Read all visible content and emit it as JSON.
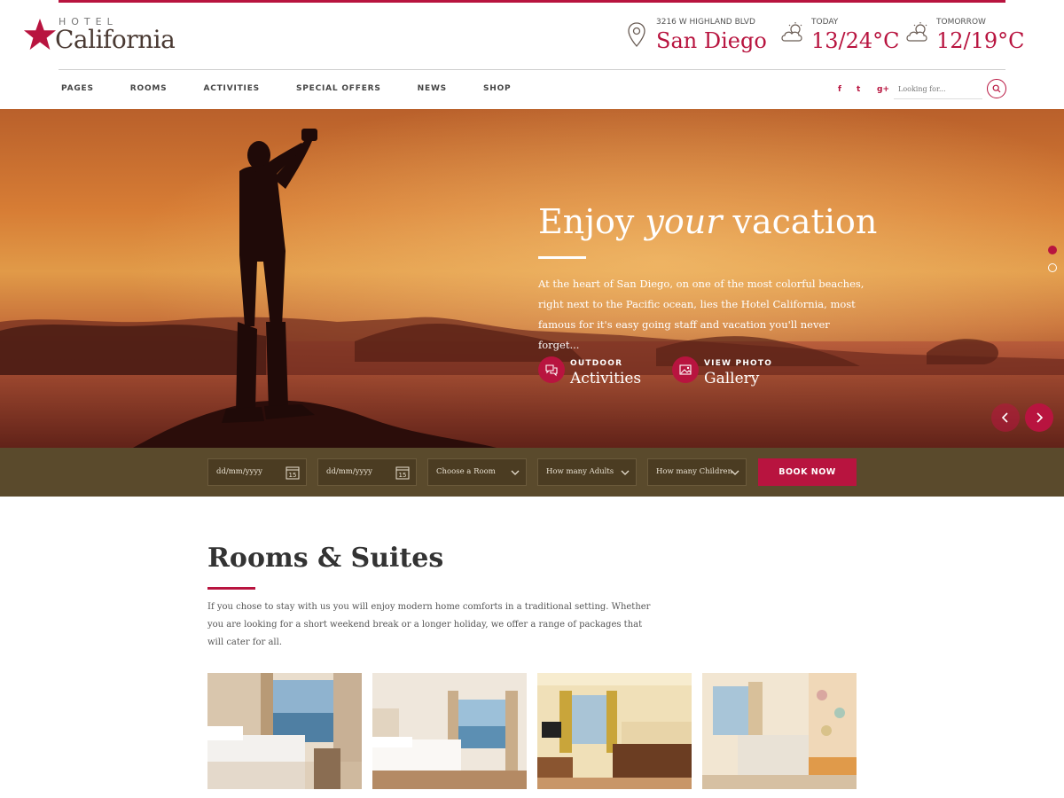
{
  "brand": {
    "top": "HOTEL",
    "name": "California"
  },
  "header": {
    "location": {
      "label": "3216 W HIGHLAND BLVD",
      "value": "San Diego"
    },
    "today": {
      "label": "TODAY",
      "value": "13/24°C"
    },
    "tomorrow": {
      "label": "TOMORROW",
      "value": "12/19°C"
    }
  },
  "nav": {
    "items": [
      "PAGES",
      "ROOMS",
      "ACTIVITIES",
      "SPECIAL OFFERS",
      "NEWS",
      "SHOP"
    ]
  },
  "social": {
    "facebook": "f",
    "twitter": "t",
    "googleplus": "g+"
  },
  "search": {
    "placeholder": "Looking for..."
  },
  "hero": {
    "title_pre": "Enjoy ",
    "title_em": "your",
    "title_post": " vacation",
    "text": "At the heart of San Diego, on one of the most colorful beaches, right next to the Pacific ocean, lies the Hotel California, most famous for it's easy going staff and vacation you'll never forget...",
    "cta1": {
      "small": "OUTDOOR",
      "big": "Activities"
    },
    "cta2": {
      "small": "VIEW PHOTO",
      "big": "Gallery"
    },
    "slides_total": 2,
    "slide_active": 1
  },
  "booking": {
    "checkin_placeholder": "dd/mm/yyyy",
    "checkout_placeholder": "dd/mm/yyyy",
    "calendar_day": "15",
    "room": "Choose a Room",
    "adults": "How many Adults",
    "children": "How many Children",
    "button": "BOOK NOW"
  },
  "rooms": {
    "title": "Rooms & Suites",
    "text": "If you chose to stay with us you will enjoy modern home comforts in a traditional setting. Whether you are looking for a short weekend break or a longer holiday, we offer a range of packages that will cater for all."
  },
  "colors": {
    "accent": "#b8143f",
    "booking_bar": "#5a4a2c"
  },
  "icons": [
    "star-icon",
    "map-pin-icon",
    "cloud-sun-icon",
    "facebook-icon",
    "twitter-icon",
    "google-plus-icon",
    "search-icon",
    "chat-bubbles-icon",
    "image-icon",
    "calendar-icon",
    "chevron-down-icon",
    "chevron-left-icon",
    "chevron-right-icon"
  ]
}
